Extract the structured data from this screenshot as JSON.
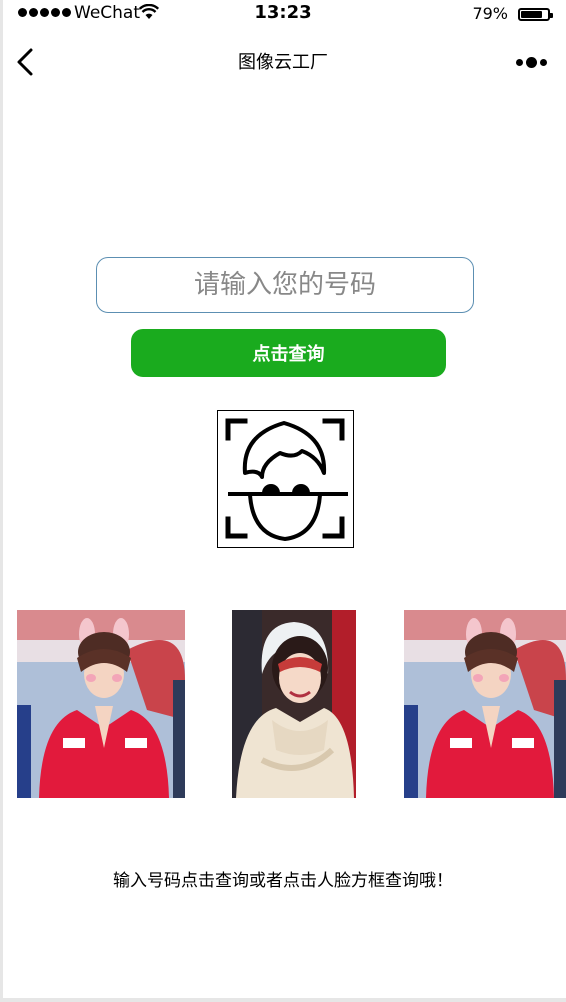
{
  "status_bar": {
    "carrier": "WeChat",
    "time": "13:23",
    "battery_percent": "79%",
    "battery_level": 0.79,
    "icons": [
      "signal-dots-icon",
      "wifi-icon",
      "battery-icon"
    ]
  },
  "nav": {
    "title": "图像云工厂",
    "icons": [
      "back-chevron-icon",
      "more-dots-icon"
    ]
  },
  "form": {
    "phone_placeholder": "请输入您的号码",
    "phone_value": "",
    "query_label": "点击查询"
  },
  "face_scan": {
    "icon": "face-scan-icon"
  },
  "photos": [
    {
      "name": "photo-girl-bunny-ears-left"
    },
    {
      "name": "photo-girl-beige-hoodie"
    },
    {
      "name": "photo-girl-bunny-ears-right"
    }
  ],
  "hint": "输入号码点击查询或者点击人脸方框查询哦！",
  "colors": {
    "primary_green": "#1aab1e",
    "input_border": "#5c8fb2",
    "background": "#ffffff"
  }
}
